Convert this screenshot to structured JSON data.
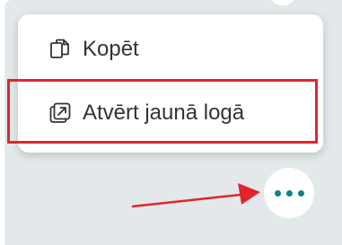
{
  "menu": {
    "items": [
      {
        "label": "Kopēt",
        "icon": "copy-icon"
      },
      {
        "label": "Atvērt jaunā logā",
        "icon": "open-in-new-window-icon"
      }
    ]
  },
  "more_button": {
    "icon": "more-horizontal-icon",
    "accent": "#0f7f8a"
  },
  "annotations": {
    "highlight_color": "#e1252f",
    "arrow_color": "#e1252f"
  }
}
